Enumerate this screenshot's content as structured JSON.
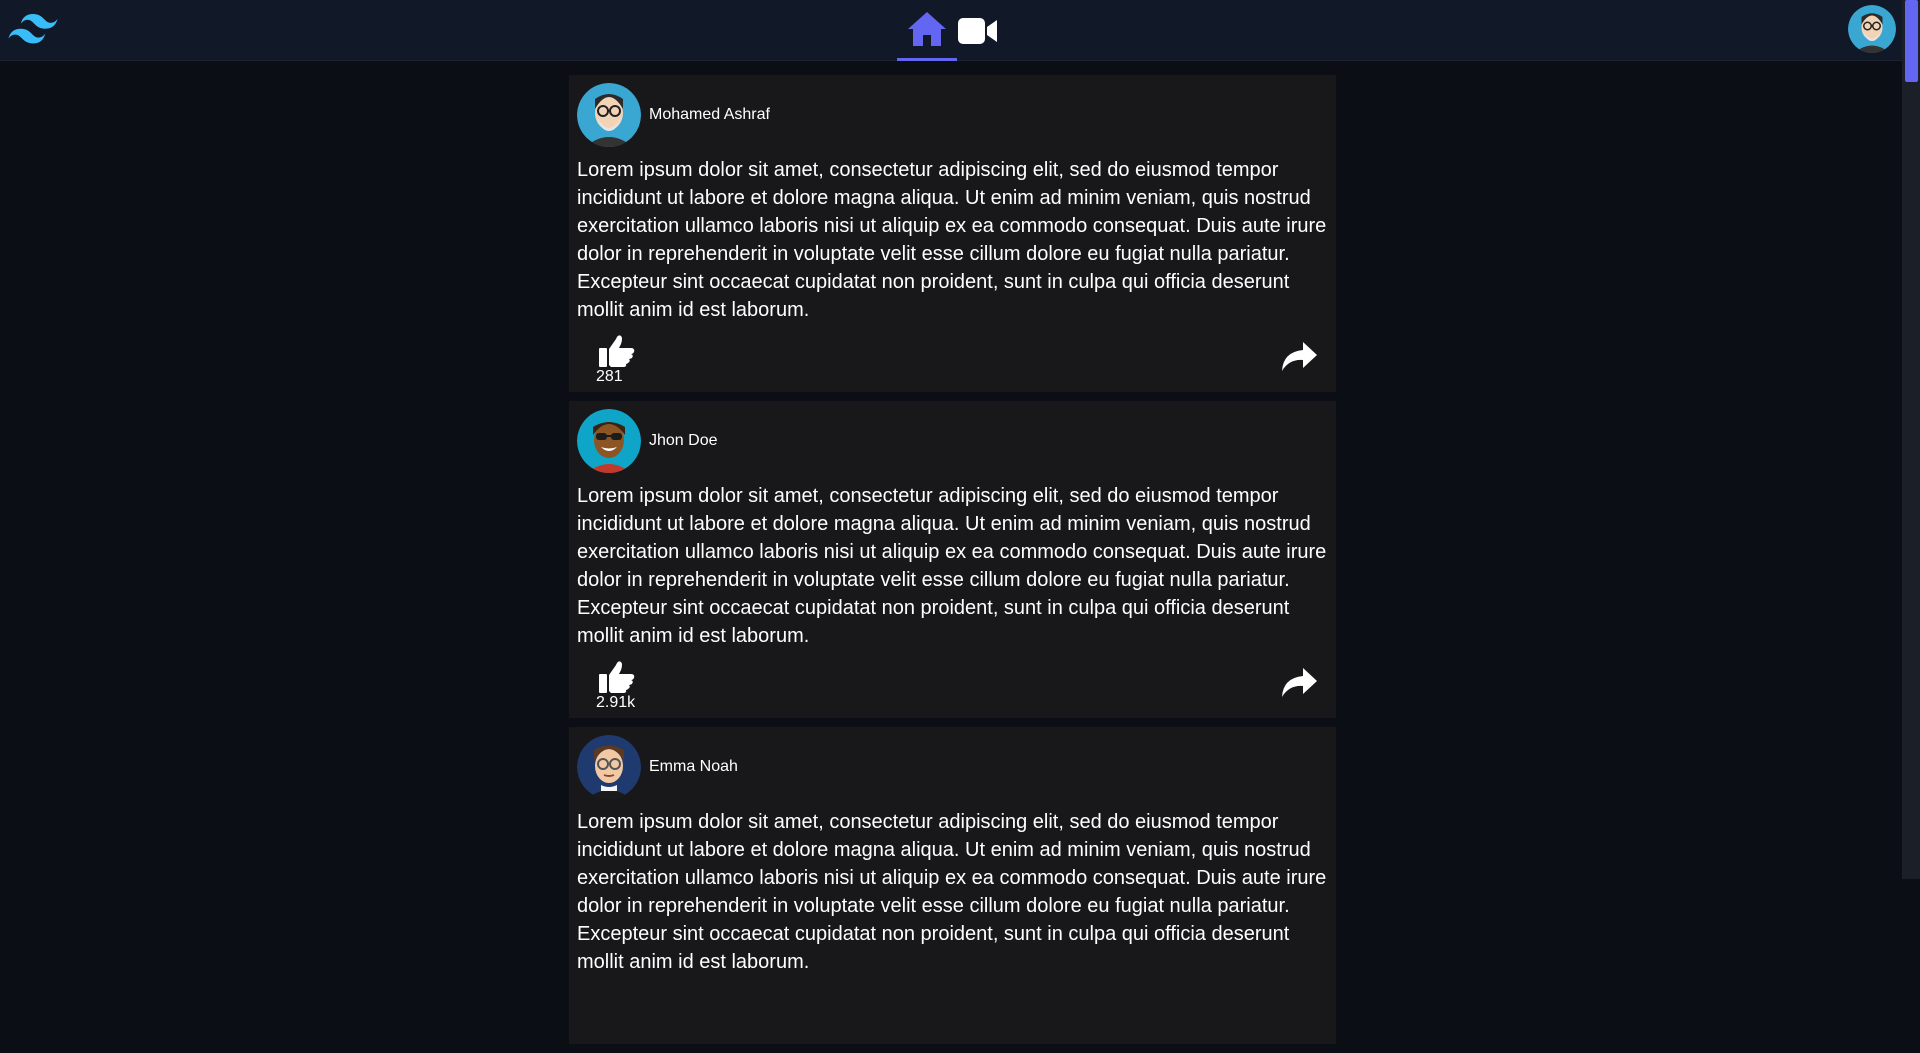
{
  "header": {
    "nav": [
      {
        "id": "home",
        "icon": "home-icon",
        "active": true
      },
      {
        "id": "video",
        "icon": "video-icon",
        "active": false
      }
    ]
  },
  "posts": [
    {
      "author": "Mohamed Ashraf",
      "text": "Lorem ipsum dolor sit amet, consectetur adipiscing elit, sed do eiusmod tempor incididunt ut labore et dolore magna aliqua. Ut enim ad minim veniam, quis nostrud exercitation ullamco laboris nisi ut aliquip ex ea commodo consequat. Duis aute irure dolor in reprehenderit in voluptate velit esse cillum dolore eu fugiat nulla pariatur. Excepteur sint occaecat cupidatat non proident, sunt in culpa qui officia deserunt mollit anim id est laborum.",
      "likes": "281"
    },
    {
      "author": "Jhon Doe",
      "text": "Lorem ipsum dolor sit amet, consectetur adipiscing elit, sed do eiusmod tempor incididunt ut labore et dolore magna aliqua. Ut enim ad minim veniam, quis nostrud exercitation ullamco laboris nisi ut aliquip ex ea commodo consequat. Duis aute irure dolor in reprehenderit in voluptate velit esse cillum dolore eu fugiat nulla pariatur. Excepteur sint occaecat cupidatat non proident, sunt in culpa qui officia deserunt mollit anim id est laborum.",
      "likes": "2.91k"
    },
    {
      "author": "Emma Noah",
      "text": "Lorem ipsum dolor sit amet, consectetur adipiscing elit, sed do eiusmod tempor incididunt ut labore et dolore magna aliqua. Ut enim ad minim veniam, quis nostrud exercitation ullamco laboris nisi ut aliquip ex ea commodo consequat. Duis aute irure dolor in reprehenderit in voluptate velit esse cillum dolore eu fugiat nulla pariatur. Excepteur sint occaecat cupidatat non proident, sunt in culpa qui officia deserunt mollit anim id est laborum.",
      "likes": ""
    }
  ],
  "colors": {
    "accent": "#6366f1",
    "logo": "#38bdf8",
    "header_bg": "#111827",
    "page_bg": "#0b0e15",
    "card_bg": "#18181b"
  }
}
